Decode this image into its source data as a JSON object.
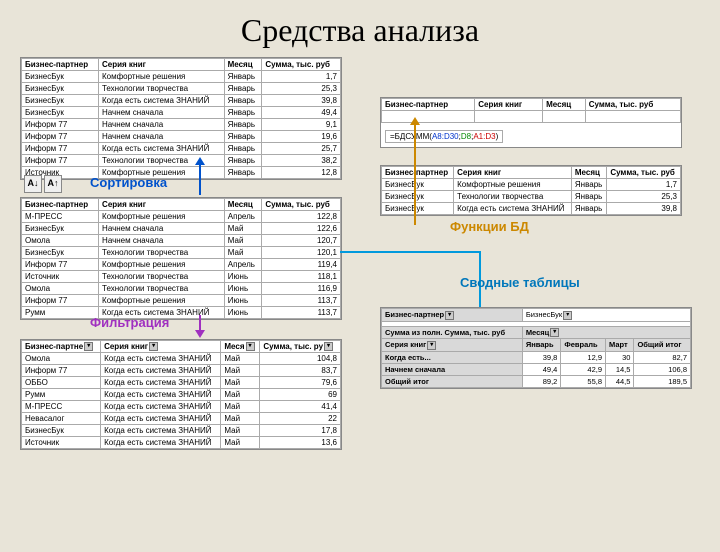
{
  "title": "Средства анализа",
  "headers": {
    "partner": "Бизнес-партнер",
    "partner_s": "Бизнес-партне",
    "series": "Серия книг",
    "month": "Месяц",
    "month_s": "Меся",
    "sum": "Сумма, тыс. руб",
    "sum_s": "Сумма, тыс. ру"
  },
  "labels": {
    "sort": "Сортировка",
    "filter": "Фильтрация",
    "dbfunc": "Функции БД",
    "pivot": "Сводные таблицы"
  },
  "table1": [
    [
      "БизнесБук",
      "Комфортные решения",
      "Январь",
      "1,7"
    ],
    [
      "БизнесБук",
      "Технологии творчества",
      "Январь",
      "25,3"
    ],
    [
      "БизнесБук",
      "Когда есть система ЗНАНИЙ",
      "Январь",
      "39,8"
    ],
    [
      "БизнесБук",
      "Начнем сначала",
      "Январь",
      "49,4"
    ],
    [
      "Информ 77",
      "Начнем сначала",
      "Январь",
      "9,1"
    ],
    [
      "Информ 77",
      "Начнем сначала",
      "Январь",
      "19,6"
    ],
    [
      "Информ 77",
      "Когда есть система ЗНАНИЙ",
      "Январь",
      "25,7"
    ],
    [
      "Информ 77",
      "Технологии творчества",
      "Январь",
      "38,2"
    ],
    [
      "Источник",
      "Комфортные решения",
      "Январь",
      "12,8"
    ]
  ],
  "table2": [
    [
      "М-ПРЕСС",
      "Комфортные решения",
      "Апрель",
      "122,8"
    ],
    [
      "БизнесБук",
      "Начнем сначала",
      "Май",
      "122,6"
    ],
    [
      "Омола",
      "Начнем сначала",
      "Май",
      "120,7"
    ],
    [
      "БизнесБук",
      "Технологии творчества",
      "Май",
      "120,1"
    ],
    [
      "Информ 77",
      "Комфортные решения",
      "Апрель",
      "119,4"
    ],
    [
      "Источник",
      "Технологии творчества",
      "Июнь",
      "118,1"
    ],
    [
      "Омола",
      "Технологии творчества",
      "Июнь",
      "116,9"
    ],
    [
      "Информ 77",
      "Комфортные решения",
      "Июнь",
      "113,7"
    ],
    [
      "Румм",
      "Когда есть система ЗНАНИЙ",
      "Июнь",
      "113,7"
    ]
  ],
  "table3": [
    [
      "Омола",
      "Когда есть система ЗНАНИЙ",
      "Май",
      "104,8"
    ],
    [
      "Информ 77",
      "Когда есть система ЗНАНИЙ",
      "Май",
      "83,7"
    ],
    [
      "ОББО",
      "Когда есть система ЗНАНИЙ",
      "Май",
      "79,6"
    ],
    [
      "Румм",
      "Когда есть система ЗНАНИЙ",
      "Май",
      "69"
    ],
    [
      "М-ПРЕСС",
      "Когда есть система ЗНАНИЙ",
      "Май",
      "41,4"
    ],
    [
      "Невасалог",
      "Когда есть система ЗНАНИЙ",
      "Май",
      "22"
    ],
    [
      "БизнесБук",
      "Когда есть система ЗНАНИЙ",
      "Май",
      "17,8"
    ],
    [
      "Источник",
      "Когда есть система ЗНАНИЙ",
      "Май",
      "13,6"
    ]
  ],
  "tableDB1": [
    [
      "",
      "",
      "",
      ""
    ]
  ],
  "formula": {
    "prefix": "=БДСУММ(",
    "arg1": "A8:D30",
    "sep1": ";",
    "arg2": "D8",
    "sep2": ";",
    "arg3": "A1:D3",
    "suffix": ")"
  },
  "tableDB2": [
    [
      "БизнесБук",
      "Комфортные решения",
      "Январь",
      "1,7"
    ],
    [
      "БизнесБук",
      "Технологии творчества",
      "Январь",
      "25,3"
    ],
    [
      "БизнесБук",
      "Когда есть система ЗНАНИЙ",
      "Январь",
      "39,8"
    ]
  ],
  "pivot": {
    "page_field": "Бизнес-партнер",
    "page_value": "БизнесБук",
    "row_field": "Серия книг",
    "col_field": "Месяц",
    "data_field": "Сумма из полн. Сумма, тыс. руб",
    "cols": [
      "Январь",
      "Февраль",
      "Март",
      "Общий итог"
    ],
    "rows": [
      [
        "Когда есть...",
        "39,8",
        "12,9",
        "30",
        "82,7"
      ],
      [
        "Начнем сначала",
        "49,4",
        "42,9",
        "14,5",
        "106,8"
      ],
      [
        "Общий итог",
        "89,2",
        "55,8",
        "44,5",
        "189,5"
      ]
    ]
  }
}
